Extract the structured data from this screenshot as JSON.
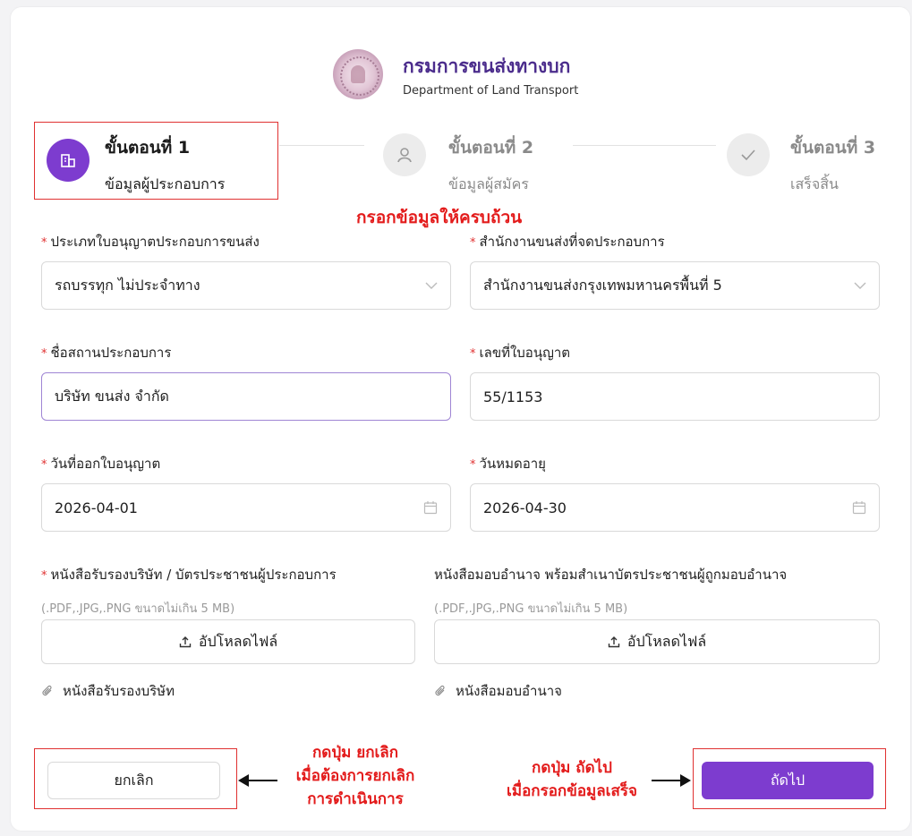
{
  "header": {
    "org_name_th": "กรมการขนส่งทางบก",
    "org_name_en": "Department of Land Transport"
  },
  "steps": [
    {
      "title": "ขั้นตอนที่ 1",
      "subtitle": "ข้อมูลผู้ประกอบการ",
      "status": "active",
      "icon": "building-icon"
    },
    {
      "title": "ขั้นตอนที่ 2",
      "subtitle": "ข้อมูลผู้สมัคร",
      "status": "pending",
      "icon": "user-icon"
    },
    {
      "title": "ขั้นตอนที่ 3",
      "subtitle": "เสร็จสิ้น",
      "status": "pending",
      "icon": "check-icon"
    }
  ],
  "annotations": {
    "fill_complete": "กรอกข้อมูลให้ครบถ้วน",
    "cancel_note": [
      "กดปุ่ม ยกเลิก",
      "เมื่อต้องการยกเลิก",
      "การดำเนินการ"
    ],
    "next_note": [
      "กดปุ่ม ถัดไป",
      "เมื่อกรอกข้อมูลเสร็จ"
    ]
  },
  "form": {
    "license_type": {
      "label": "ประเภทใบอนุญาตประกอบการขนส่ง",
      "value": "รถบรรทุก ไม่ประจำทาง",
      "required": true
    },
    "office": {
      "label": "สำนักงานขนส่งที่จดประกอบการ",
      "value": "สำนักงานขนส่งกรุงเทพมหานครพื้นที่ 5",
      "required": true
    },
    "business_name": {
      "label": "ชื่อสถานประกอบการ",
      "value": "บริษัท ขนส่ง จำกัด",
      "required": true
    },
    "license_no": {
      "label": "เลขที่ใบอนุญาต",
      "value": "55/1153",
      "required": true
    },
    "issue_date": {
      "label": "วันที่ออกใบอนุญาต",
      "value": "2026-04-01",
      "required": true
    },
    "expiry_date": {
      "label": "วันหมดอายุ",
      "value": "2026-04-30",
      "required": true
    },
    "doc_company": {
      "label": "หนังสือรับรองบริษัท / บัตรประชาชนผู้ประกอบการ",
      "hint": "(.PDF,.JPG,.PNG ขนาดไม่เกิน 5 MB)",
      "upload_label": "อัปโหลดไฟล์",
      "attached_file": "หนังสือรับรองบริษัท",
      "required": true
    },
    "doc_power": {
      "label": "หนังสือมอบอำนาจ พร้อมสำเนาบัตรประชาชนผู้ถูกมอบอำนาจ",
      "hint": "(.PDF,.JPG,.PNG ขนาดไม่เกิน 5 MB)",
      "upload_label": "อัปโหลดไฟล์",
      "attached_file": "หนังสือมอบอำนาจ",
      "required": false
    }
  },
  "buttons": {
    "cancel": "ยกเลิก",
    "next": "ถัดไป"
  },
  "colors": {
    "primary": "#7d3ccf",
    "brand_text": "#4b2c8c",
    "annotation_red": "#e31b1b"
  }
}
